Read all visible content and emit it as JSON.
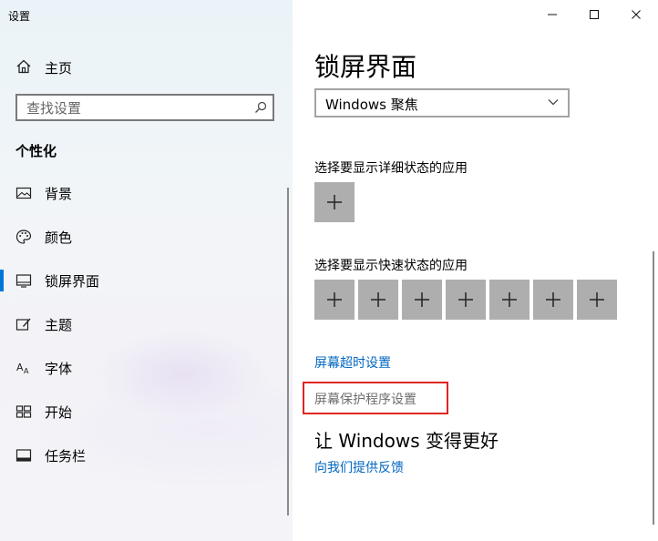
{
  "window": {
    "title": "设置",
    "controls": {
      "minimize": "minimize-icon",
      "maximize": "maximize-icon",
      "close": "close-icon"
    }
  },
  "sidebar": {
    "home_label": "主页",
    "search_placeholder": "查找设置",
    "section_title": "个性化",
    "items": [
      {
        "label": "背景",
        "icon": "picture-icon"
      },
      {
        "label": "颜色",
        "icon": "palette-icon"
      },
      {
        "label": "锁屏界面",
        "icon": "lock-screen-icon",
        "selected": true
      },
      {
        "label": "主题",
        "icon": "theme-brush-icon"
      },
      {
        "label": "字体",
        "icon": "font-icon"
      },
      {
        "label": "开始",
        "icon": "start-grid-icon"
      },
      {
        "label": "任务栏",
        "icon": "taskbar-icon"
      }
    ],
    "accent_color": "#0078d7"
  },
  "main": {
    "title": "锁屏界面",
    "background_select": {
      "value": "Windows 聚焦"
    },
    "detailed_status_label": "选择要显示详细状态的应用",
    "quick_status_label": "选择要显示快速状态的应用",
    "quick_status_slot_count": 7,
    "screen_timeout_link": "屏幕超时设置",
    "screensaver_link": "屏幕保护程序设置",
    "improve_heading": "让 Windows 变得更好",
    "feedback_link": "向我们提供反馈",
    "link_color": "#0067c0",
    "highlight_color": "#e02424"
  }
}
